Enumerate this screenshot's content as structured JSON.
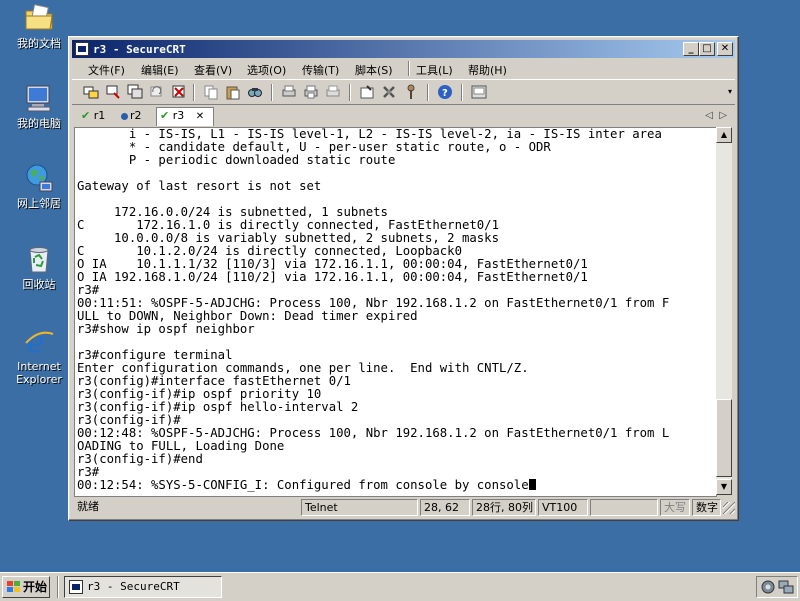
{
  "desktop": {
    "icons": [
      {
        "label": "我的文档"
      },
      {
        "label": "我的电脑"
      },
      {
        "label": "网上邻居"
      },
      {
        "label": "回收站"
      },
      {
        "label_line1": "Internet",
        "label_line2": "Explorer"
      }
    ]
  },
  "window": {
    "title": "r3 - SecureCRT",
    "buttons": {
      "minimize": "_",
      "maximize": "□",
      "close": "✕"
    }
  },
  "menu": {
    "file": "文件(F)",
    "edit": "编辑(E)",
    "view": "查看(V)",
    "options": "选项(O)",
    "transfer": "传输(T)",
    "script": "脚本(S)",
    "tools": "工具(L)",
    "help": "帮助(H)"
  },
  "tabs": [
    {
      "label": "r1",
      "status": "check"
    },
    {
      "label": "r2",
      "status": "dot"
    },
    {
      "label": "r3",
      "status": "check",
      "close": "✕"
    }
  ],
  "terminal": {
    "lines": [
      "       i - IS-IS, L1 - IS-IS level-1, L2 - IS-IS level-2, ia - IS-IS inter area",
      "       * - candidate default, U - per-user static route, o - ODR",
      "       P - periodic downloaded static route",
      "",
      "Gateway of last resort is not set",
      "",
      "     172.16.0.0/24 is subnetted, 1 subnets",
      "C       172.16.1.0 is directly connected, FastEthernet0/1",
      "     10.0.0.0/8 is variably subnetted, 2 subnets, 2 masks",
      "C       10.1.2.0/24 is directly connected, Loopback0",
      "O IA    10.1.1.1/32 [110/3] via 172.16.1.1, 00:00:04, FastEthernet0/1",
      "O IA 192.168.1.0/24 [110/2] via 172.16.1.1, 00:00:04, FastEthernet0/1",
      "r3#",
      "00:11:51: %OSPF-5-ADJCHG: Process 100, Nbr 192.168.1.2 on FastEthernet0/1 from F",
      "ULL to DOWN, Neighbor Down: Dead timer expired",
      "r3#show ip ospf neighbor",
      "",
      "r3#configure terminal",
      "Enter configuration commands, one per line.  End with CNTL/Z.",
      "r3(config)#interface fastEthernet 0/1",
      "r3(config-if)#ip ospf priority 10",
      "r3(config-if)#ip ospf hello-interval 2",
      "r3(config-if)#",
      "00:12:48: %OSPF-5-ADJCHG: Process 100, Nbr 192.168.1.2 on FastEthernet0/1 from L",
      "OADING to FULL, Loading Done",
      "r3(config-if)#end",
      "r3#",
      "00:12:54: %SYS-5-CONFIG_I: Configured from console by console"
    ]
  },
  "statusbar": {
    "ready": "就绪",
    "protocol": "Telnet",
    "cursor_pos": "28, 62",
    "rows_cols": "28行, 80列",
    "emulation": "VT100",
    "caps": "大写",
    "num": "数字"
  },
  "taskbar": {
    "start": "开始",
    "task": "r3 - SecureCRT"
  },
  "colors": {
    "desktop": "#3a6ea5",
    "titlebar_start": "#0a246a",
    "titlebar_end": "#a6caf0",
    "chrome": "#d4d0c8"
  }
}
